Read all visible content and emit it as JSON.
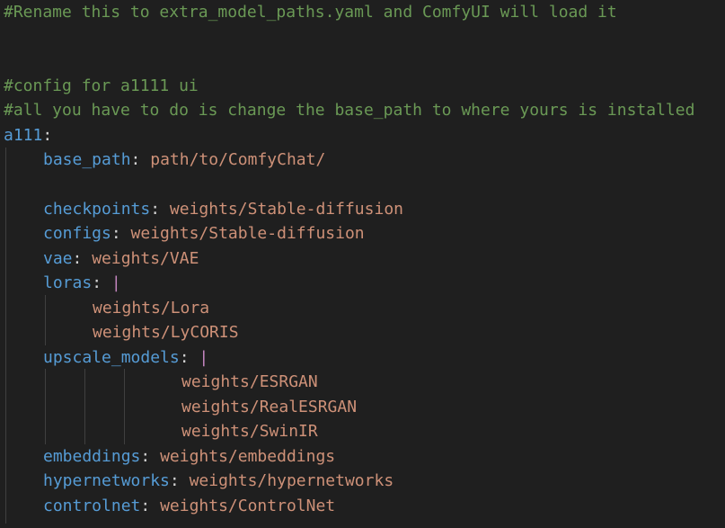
{
  "comments": {
    "rename": "#Rename this to extra_model_paths.yaml and ComfyUI will load it",
    "config": "#config for a1111 ui",
    "instructions": "#all you have to do is change the base_path to where yours is installed"
  },
  "root_key": "a111",
  "entries": {
    "base_path": {
      "key": "base_path",
      "value": "path/to/ComfyChat/"
    },
    "checkpoints": {
      "key": "checkpoints",
      "value": "weights/Stable-diffusion"
    },
    "configs": {
      "key": "configs",
      "value": "weights/Stable-diffusion"
    },
    "vae": {
      "key": "vae",
      "value": "weights/VAE"
    },
    "loras": {
      "key": "loras",
      "pipe": "|",
      "items": [
        "weights/Lora",
        "weights/LyCORIS"
      ]
    },
    "upscale_models": {
      "key": "upscale_models",
      "pipe": "|",
      "items": [
        "weights/ESRGAN",
        "weights/RealESRGAN",
        "weights/SwinIR"
      ]
    },
    "embeddings": {
      "key": "embeddings",
      "value": "weights/embeddings"
    },
    "hypernetworks": {
      "key": "hypernetworks",
      "value": "weights/hypernetworks"
    },
    "controlnet": {
      "key": "controlnet",
      "value": "weights/ControlNet"
    }
  },
  "colors": {
    "background": "#1f1f1f",
    "comment": "#6a9955",
    "key": "#569cd6",
    "value": "#ce9178",
    "pipe": "#c586c0"
  }
}
